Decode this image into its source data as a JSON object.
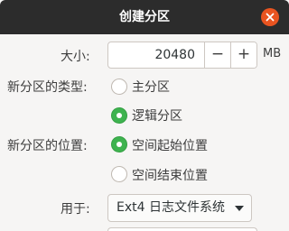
{
  "dialog": {
    "title": "创建分区"
  },
  "size": {
    "label": "大小:",
    "value": "20480",
    "minus": "−",
    "plus": "+",
    "unit": "MB"
  },
  "partition_type": {
    "label": "新分区的类型:",
    "options": [
      {
        "label": "主分区",
        "selected": false
      },
      {
        "label": "逻辑分区",
        "selected": true
      }
    ]
  },
  "location": {
    "label": "新分区的位置:",
    "options": [
      {
        "label": "空间起始位置",
        "selected": true
      },
      {
        "label": "空间结束位置",
        "selected": false
      }
    ]
  },
  "use_as": {
    "label": "用于:",
    "selected": "Ext4 日志文件系统"
  },
  "colors": {
    "titlebar": "#2c2c2c",
    "close": "#e95420",
    "radio_selected": "#3eb34f",
    "background": "#f6f5f4"
  }
}
